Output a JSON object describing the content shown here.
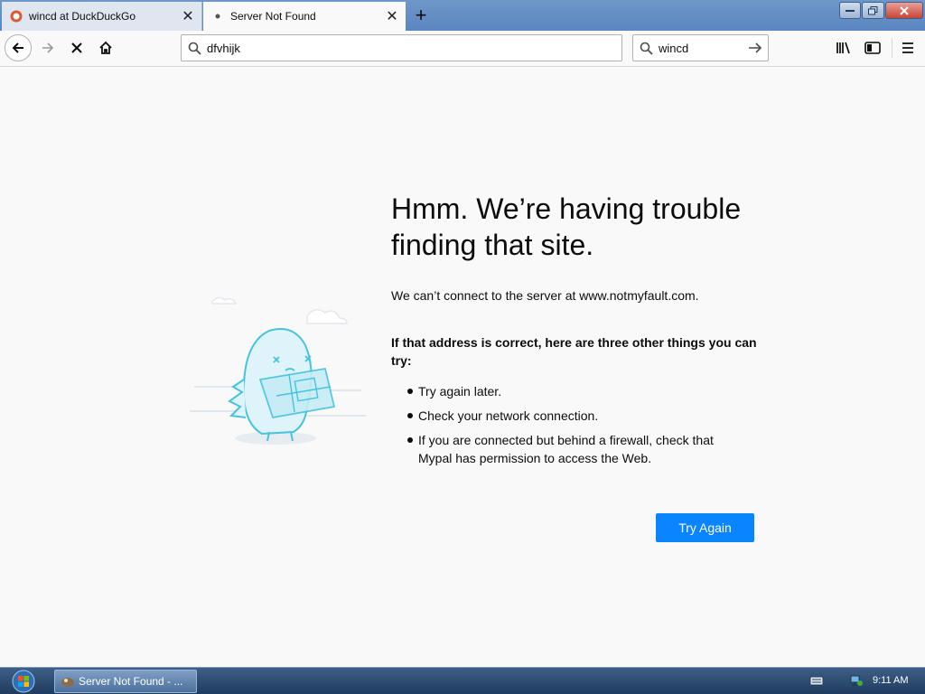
{
  "tabs": [
    {
      "title": "wincd at DuckDuckGo",
      "active": false
    },
    {
      "title": "Server Not Found",
      "active": true
    }
  ],
  "toolbar": {
    "url": "dfvhijk",
    "search_value": "wincd"
  },
  "error": {
    "title": "Hmm. We’re having trouble finding that site.",
    "description": "We can’t connect to the server at www.notmyfault.com.",
    "suggestions_heading": "If that address is correct, here are three other things you can try:",
    "suggestions": [
      "Try again later.",
      "Check your network connection.",
      "If you are connected but behind a firewall, check that Mypal has permission to access the Web."
    ],
    "button_label": "Try Again"
  },
  "taskbar": {
    "task_label": "Server Not Found - ...",
    "clock": "9:11 AM"
  },
  "colors": {
    "accent": "#0a84ff",
    "page_bg": "#f9f9fa",
    "illustration": "#45c3e0"
  }
}
